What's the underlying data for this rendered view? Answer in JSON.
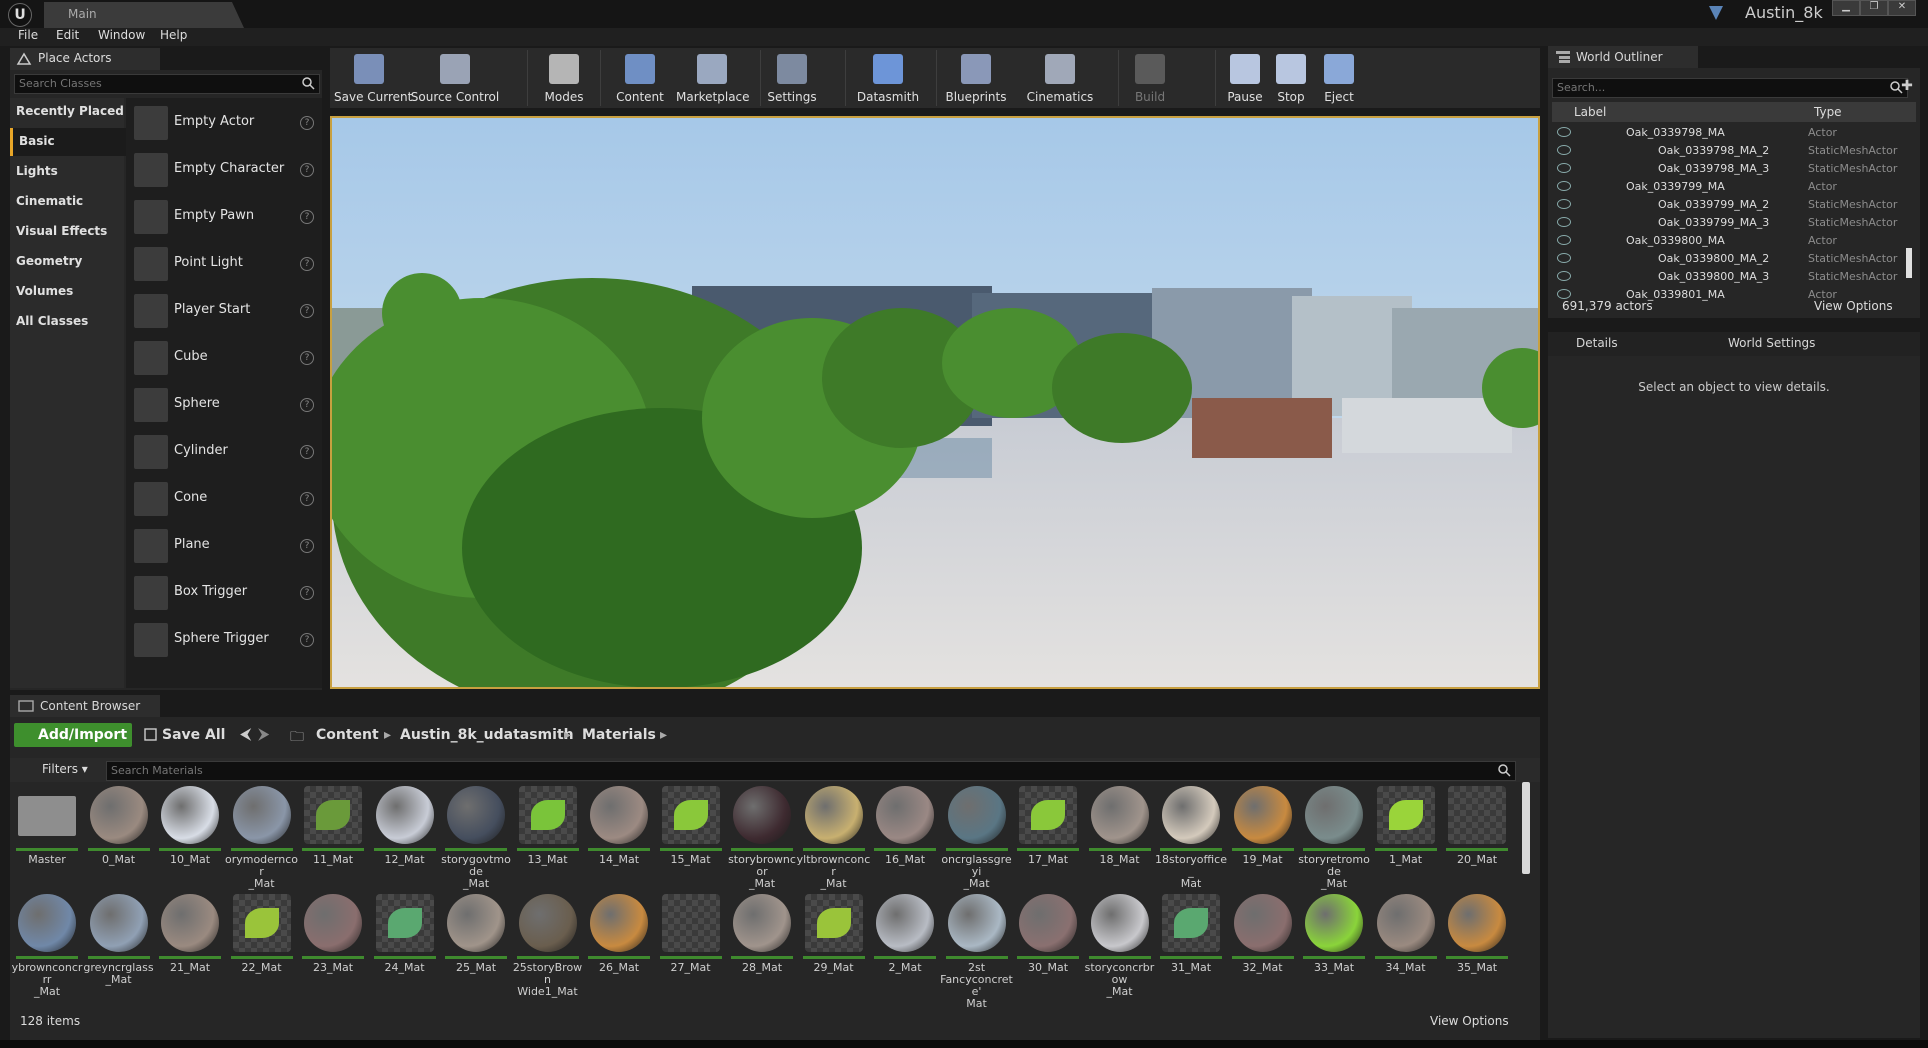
{
  "window": {
    "app_logo": "U",
    "tab_title": "Main",
    "project_name": "Austin_8k",
    "controls": [
      "▁",
      "❐",
      "✕"
    ]
  },
  "menu": [
    "File",
    "Edit",
    "Window",
    "Help"
  ],
  "place_actors": {
    "tab_label": "Place Actors",
    "search_placeholder": "Search Classes",
    "categories": [
      "Recently Placed",
      "Basic",
      "Lights",
      "Cinematic",
      "Visual Effects",
      "Geometry",
      "Volumes",
      "All Classes"
    ],
    "active_category": "Basic",
    "items": [
      "Empty Actor",
      "Empty Character",
      "Empty Pawn",
      "Point Light",
      "Player Start",
      "Cube",
      "Sphere",
      "Cylinder",
      "Cone",
      "Plane",
      "Box Trigger",
      "Sphere Trigger"
    ]
  },
  "toolbar": [
    {
      "label": "Save Current",
      "icon": "save-icon",
      "color": "#7a8fb8"
    },
    {
      "label": "Source Control",
      "icon": "source-control-icon",
      "color": "#9aa3b5"
    },
    {
      "label": "Modes",
      "icon": "modes-icon",
      "color": "#b5b5b5"
    },
    {
      "label": "Content",
      "icon": "content-icon",
      "color": "#6f8fc4"
    },
    {
      "label": "Marketplace",
      "icon": "marketplace-icon",
      "color": "#9aa8c0"
    },
    {
      "label": "Settings",
      "icon": "settings-icon",
      "color": "#7d8aa0"
    },
    {
      "label": "Datasmith",
      "icon": "datasmith-icon",
      "color": "#6d95d8"
    },
    {
      "label": "Blueprints",
      "icon": "blueprints-icon",
      "color": "#8a98b8"
    },
    {
      "label": "Cinematics",
      "icon": "cinematics-icon",
      "color": "#a0a8b8"
    },
    {
      "label": "Build",
      "icon": "build-icon",
      "color": "#5a5a5a"
    },
    {
      "label": "Pause",
      "icon": "pause-icon",
      "color": "#b8c6e0"
    },
    {
      "label": "Stop",
      "icon": "stop-icon",
      "color": "#b8c6e0"
    },
    {
      "label": "Eject",
      "icon": "eject-icon",
      "color": "#8aa8d8"
    }
  ],
  "world_outliner": {
    "tab_label": "World Outliner",
    "search_placeholder": "Search...",
    "col_label": "Label",
    "col_type": "Type",
    "rows": [
      {
        "label": "Oak_0339798_MA",
        "type": "Actor",
        "indent": 0
      },
      {
        "label": "Oak_0339798_MA_2",
        "type": "StaticMeshActor",
        "indent": 1
      },
      {
        "label": "Oak_0339798_MA_3",
        "type": "StaticMeshActor",
        "indent": 1
      },
      {
        "label": "Oak_0339799_MA",
        "type": "Actor",
        "indent": 0
      },
      {
        "label": "Oak_0339799_MA_2",
        "type": "StaticMeshActor",
        "indent": 1
      },
      {
        "label": "Oak_0339799_MA_3",
        "type": "StaticMeshActor",
        "indent": 1
      },
      {
        "label": "Oak_0339800_MA",
        "type": "Actor",
        "indent": 0
      },
      {
        "label": "Oak_0339800_MA_2",
        "type": "StaticMeshActor",
        "indent": 1
      },
      {
        "label": "Oak_0339800_MA_3",
        "type": "StaticMeshActor",
        "indent": 1
      },
      {
        "label": "Oak_0339801_MA",
        "type": "Actor",
        "indent": 0
      }
    ],
    "actor_count": "691,379 actors",
    "view_options": "View Options"
  },
  "details": {
    "tab_details": "Details",
    "tab_world_settings": "World Settings",
    "empty_message": "Select an object to view details."
  },
  "content_browser": {
    "tab_label": "Content Browser",
    "add_import": "Add/Import",
    "save_all": "Save All",
    "breadcrumbs": [
      "Content",
      "Austin_8k_udatasmith",
      "Materials"
    ],
    "filters": "Filters",
    "search_placeholder": "Search Materials",
    "item_count": "128 items",
    "view_options": "View Options",
    "assets_row1": [
      {
        "label": "Master",
        "kind": "folder"
      },
      {
        "label": "0_Mat",
        "kind": "ball",
        "color": "#9a8a80"
      },
      {
        "label": "10_Mat",
        "kind": "ball",
        "color": "#d8dde6"
      },
      {
        "label": "orymoderncor\n_Mat",
        "kind": "ball",
        "color": "#8a96a8"
      },
      {
        "label": "11_Mat",
        "kind": "leaf",
        "color": "#6a9a3a"
      },
      {
        "label": "12_Mat",
        "kind": "ball",
        "color": "#c8ccd6"
      },
      {
        "label": "storygovtmode\n_Mat",
        "kind": "ball",
        "color": "#454e5e"
      },
      {
        "label": "13_Mat",
        "kind": "leaf",
        "color": "#7ac43a"
      },
      {
        "label": "14_Mat",
        "kind": "ball",
        "color": "#9c8a82"
      },
      {
        "label": "15_Mat",
        "kind": "leaf",
        "color": "#8ac83a"
      },
      {
        "label": "storybrowncor\n_Mat",
        "kind": "ball",
        "color": "#3e2a30"
      },
      {
        "label": "yltbrownconcr\n_Mat",
        "kind": "ball",
        "color": "#c8b070"
      },
      {
        "label": "16_Mat",
        "kind": "ball",
        "color": "#9a8884"
      },
      {
        "label": "oncrglassgreyi\n_Mat",
        "kind": "ball",
        "color": "#5a7684"
      },
      {
        "label": "17_Mat",
        "kind": "leaf",
        "color": "#8ac83a"
      },
      {
        "label": "18_Mat",
        "kind": "ball",
        "color": "#a0948c"
      },
      {
        "label": "18storyoffice_\nMat",
        "kind": "ball",
        "color": "#d4cabc"
      },
      {
        "label": "19_Mat",
        "kind": "ball",
        "color": "#c88a40"
      },
      {
        "label": "storyretromode\n_Mat",
        "kind": "ball",
        "color": "#7a8c8c"
      },
      {
        "label": "1_Mat",
        "kind": "leaf",
        "color": "#9ad43a"
      },
      {
        "label": "20_Mat",
        "kind": "twig",
        "color": "#8a8a8a"
      }
    ],
    "assets_row2": [
      {
        "label": "ybrownconcrrr\n_Mat",
        "kind": "ball",
        "color": "#7088a8"
      },
      {
        "label": "greyncrglass\n_Mat",
        "kind": "ball",
        "color": "#90a0b4"
      },
      {
        "label": "21_Mat",
        "kind": "ball",
        "color": "#9a8a80"
      },
      {
        "label": "22_Mat",
        "kind": "leaf",
        "color": "#9ac43a"
      },
      {
        "label": "23_Mat",
        "kind": "ball",
        "color": "#8a6e6e"
      },
      {
        "label": "24_Mat",
        "kind": "leaf",
        "color": "#5aa870"
      },
      {
        "label": "25_Mat",
        "kind": "ball",
        "color": "#a0948a"
      },
      {
        "label": "25storyBrown\nWide1_Mat",
        "kind": "ball",
        "color": "#6a5e4e"
      },
      {
        "label": "26_Mat",
        "kind": "ball",
        "color": "#c88a40"
      },
      {
        "label": "27_Mat",
        "kind": "twig",
        "color": "#8a8a8a"
      },
      {
        "label": "28_Mat",
        "kind": "ball",
        "color": "#a0948c"
      },
      {
        "label": "29_Mat",
        "kind": "leaf",
        "color": "#9ac43a"
      },
      {
        "label": "2_Mat",
        "kind": "ball",
        "color": "#b8bcc4"
      },
      {
        "label": "2st\nFancyconcrete'\nMat",
        "kind": "ball",
        "color": "#aab8c4"
      },
      {
        "label": "30_Mat",
        "kind": "ball",
        "color": "#8a7070"
      },
      {
        "label": "storyconcrbrow\n_Mat",
        "kind": "ball",
        "color": "#c8c8cc"
      },
      {
        "label": "31_Mat",
        "kind": "leaf",
        "color": "#5aa870"
      },
      {
        "label": "32_Mat",
        "kind": "ball",
        "color": "#8a6e6e"
      },
      {
        "label": "33_Mat",
        "kind": "ball",
        "color": "#8ad43a"
      },
      {
        "label": "34_Mat",
        "kind": "ball",
        "color": "#9a8a80"
      },
      {
        "label": "35_Mat",
        "kind": "ball",
        "color": "#c88a40"
      }
    ]
  }
}
